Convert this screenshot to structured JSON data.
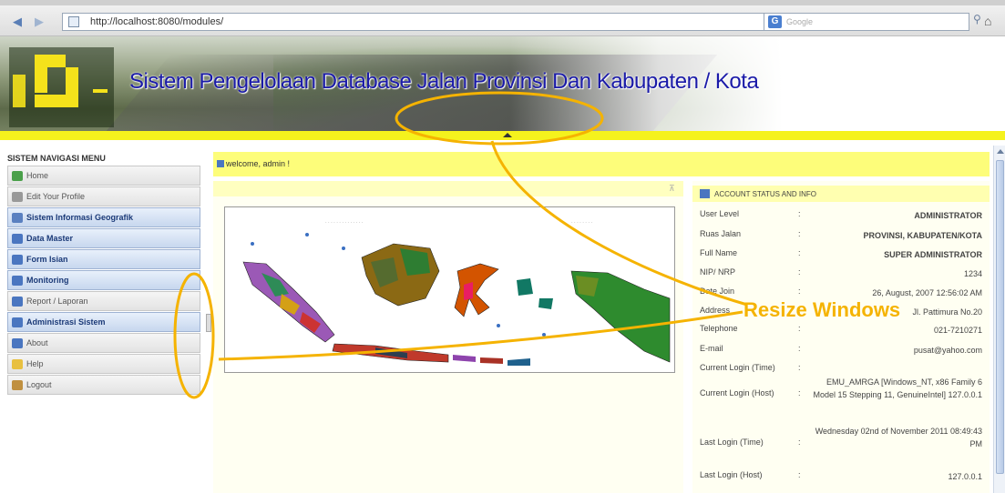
{
  "browser": {
    "url": "http://localhost:8080/modules/",
    "search_placeholder": "Google",
    "search_engine_label": "G"
  },
  "header": {
    "title": "Sistem Pengelolaan Database Jalan Provinsi Dan Kabupaten / Kota"
  },
  "sidebar": {
    "title": "SISTEM NAVIGASI MENU",
    "items": [
      {
        "label": "Home",
        "style": "grey",
        "icon_color": "#4aa04a"
      },
      {
        "label": "Edit Your Profile",
        "style": "grey",
        "icon_color": "#999999"
      },
      {
        "label": "Sistem Informasi Geografik",
        "style": "blue",
        "icon_color": "#5a80c0"
      },
      {
        "label": "Data Master",
        "style": "blue",
        "icon_color": "#4a76c0"
      },
      {
        "label": "Form Isian",
        "style": "blue",
        "icon_color": "#4a76c0"
      },
      {
        "label": "Monitoring",
        "style": "blue",
        "icon_color": "#4a76c0"
      },
      {
        "label": "Report / Laporan",
        "style": "grey",
        "icon_color": "#4a76c0"
      },
      {
        "label": "Administrasi Sistem",
        "style": "blue",
        "icon_color": "#4a76c0"
      },
      {
        "label": "About",
        "style": "grey",
        "icon_color": "#4a76c0"
      },
      {
        "label": "Help",
        "style": "grey",
        "icon_color": "#e8c040"
      },
      {
        "label": "Logout",
        "style": "grey",
        "icon_color": "#c09040"
      }
    ]
  },
  "welcome": {
    "text": "welcome, admin !"
  },
  "account": {
    "header": "ACCOUNT STATUS AND INFO",
    "rows": [
      {
        "label": "User Level",
        "value": "ADMINISTRATOR"
      },
      {
        "label": "Ruas Jalan",
        "value": "PROVINSI, KABUPATEN/KOTA"
      },
      {
        "label": "Full Name",
        "value": "SUPER ADMINISTRATOR"
      },
      {
        "label": "NIP/ NRP",
        "value": "1234"
      },
      {
        "label": "Date Join",
        "value": "26, August, 2007 12:56:02 AM"
      },
      {
        "label": "Address",
        "value": "Jl. Pattimura No.20"
      },
      {
        "label": "Telephone",
        "value": "021-7210271"
      },
      {
        "label": "E-mail",
        "value": "pusat@yahoo.com"
      },
      {
        "label": "Current Login (Time)",
        "value": ""
      },
      {
        "label": "Current Login (Host)",
        "value": "EMU_AMRGA [Windows_NT, x86 Family 6 Model 15 Stepping 11, GenuineIntel] 127.0.0.1"
      },
      {
        "label": "Last Login (Time)",
        "value": "Wednesday 02nd of November 2011 08:49:43 PM"
      },
      {
        "label": "Last Login (Host)",
        "value": "127.0.0.1"
      }
    ]
  },
  "annotation": {
    "label": "Resize Windows",
    "color": "#f5b301"
  }
}
